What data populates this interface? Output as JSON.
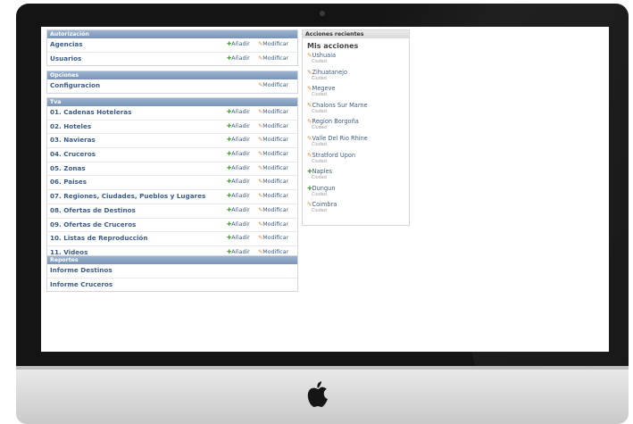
{
  "modules": [
    {
      "caption": "Autorización",
      "rows": [
        {
          "name": "Agencias",
          "add": "Añadir",
          "change": "Modificar"
        },
        {
          "name": "Usuarios",
          "add": "Añadir",
          "change": "Modificar"
        }
      ]
    },
    {
      "caption": "Opciones",
      "rows": [
        {
          "name": "Configuracion",
          "add": "",
          "change": "Modificar"
        }
      ]
    },
    {
      "caption": "Tva",
      "rows": [
        {
          "name": "01. Cadenas Hoteleras",
          "add": "Añadir",
          "change": "Modificar"
        },
        {
          "name": "02. Hoteles",
          "add": "Añadir",
          "change": "Modificar"
        },
        {
          "name": "03. Navieras",
          "add": "Añadir",
          "change": "Modificar"
        },
        {
          "name": "04. Cruceros",
          "add": "Añadir",
          "change": "Modificar"
        },
        {
          "name": "05. Zonas",
          "add": "Añadir",
          "change": "Modificar"
        },
        {
          "name": "06. Paises",
          "add": "Añadir",
          "change": "Modificar"
        },
        {
          "name": "07. Regiones, Ciudades, Pueblos y Lugares",
          "add": "Añadir",
          "change": "Modificar"
        },
        {
          "name": "08. Ofertas de Destinos",
          "add": "Añadir",
          "change": "Modificar"
        },
        {
          "name": "09. Ofertas de Cruceros",
          "add": "Añadir",
          "change": "Modificar"
        },
        {
          "name": "10. Listas de Reproducción",
          "add": "Añadir",
          "change": "Modificar"
        },
        {
          "name": "11. Videos",
          "add": "Añadir",
          "change": "Modificar"
        }
      ]
    },
    {
      "caption": "Reportes",
      "rows": [
        {
          "name": "Informe Destinos",
          "add": "",
          "change": ""
        },
        {
          "name": "Informe Cruceros",
          "add": "",
          "change": ""
        }
      ]
    }
  ],
  "recent": {
    "caption": "Acciones recientes",
    "title": "Mis acciones",
    "items": [
      {
        "name": "Ushuaia",
        "type": "Ciudad",
        "action": "change"
      },
      {
        "name": "Zihuatanejo",
        "type": "Ciudad",
        "action": "change"
      },
      {
        "name": "Megeve",
        "type": "Ciudad",
        "action": "change"
      },
      {
        "name": "Chalons Sur Marne",
        "type": "Ciudad",
        "action": "change"
      },
      {
        "name": "Region Borgoña",
        "type": "Ciudad",
        "action": "change"
      },
      {
        "name": "Valle Del Rio Rhine",
        "type": "Ciudad",
        "action": "change"
      },
      {
        "name": "Stratford Upon",
        "type": "Ciudad",
        "action": "change"
      },
      {
        "name": "Naples",
        "type": "Ciudad",
        "action": "add"
      },
      {
        "name": "Dungun",
        "type": "Ciudad",
        "action": "add"
      },
      {
        "name": "Coimbra",
        "type": "Ciudad",
        "action": "change"
      }
    ]
  },
  "icons": {
    "add": "plus-icon",
    "change": "pencil-icon",
    "logo": "apple-logo-icon"
  },
  "colors": {
    "link": "#3d5d86",
    "caption": "#7994b8",
    "add_icon": "#4ca23a",
    "change_icon": "#d4893b"
  }
}
